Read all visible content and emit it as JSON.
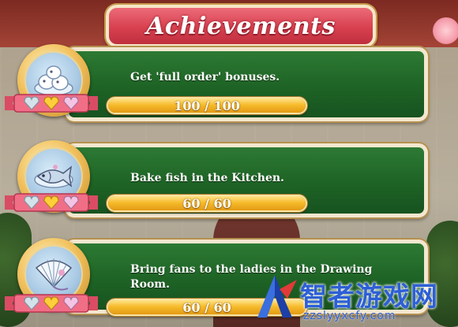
{
  "title": "Achievements",
  "achievements": [
    {
      "description": "Get 'full order' bonuses.",
      "progress_label": "100 / 100",
      "progress_fraction": 1.0,
      "icon": "pastry-buns-icon",
      "gems": [
        "silver-heart-gem",
        "gold-heart-gem",
        "pink-heart-gem"
      ]
    },
    {
      "description": "Bake fish in the Kitchen.",
      "progress_label": "60 / 60",
      "progress_fraction": 1.0,
      "icon": "baked-fish-icon",
      "gems": [
        "silver-heart-gem",
        "gold-heart-gem",
        "pink-heart-gem"
      ]
    },
    {
      "description": "Bring fans to the ladies in the Drawing Room.",
      "progress_label": "60 / 60",
      "progress_fraction": 1.0,
      "icon": "hand-fan-icon",
      "gems": [
        "silver-heart-gem",
        "gold-heart-gem",
        "pink-heart-gem"
      ]
    }
  ],
  "watermark": {
    "name": "智者游戏网",
    "url": "zzslyyxcfy.com",
    "icon": "zhizhe-logo-icon"
  },
  "colors": {
    "panel_green": "#1f6526",
    "banner_red": "#d8404f",
    "bar_gold": "#f6bb2c",
    "watermark_blue": "#2d5fd6"
  }
}
